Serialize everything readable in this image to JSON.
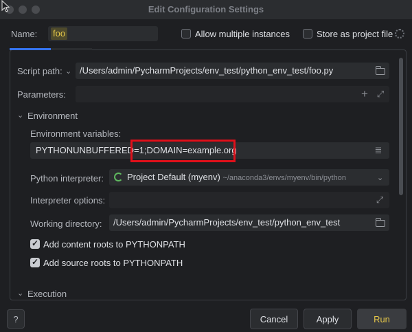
{
  "window": {
    "title": "Edit Configuration Settings"
  },
  "header": {
    "name_label": "Name:",
    "name_value": "foo",
    "allow_multiple_label": "Allow multiple instances",
    "allow_multiple_checked": false,
    "store_project_label": "Store as project file",
    "store_project_checked": false
  },
  "script": {
    "label": "Script path:",
    "value": "/Users/admin/PycharmProjects/env_test/python_env_test/foo.py"
  },
  "parameters": {
    "label": "Parameters:",
    "value": ""
  },
  "environment": {
    "section_label": "Environment",
    "env_vars_label": "Environment variables:",
    "env_vars_prefix": "PYTHONUNBUFFERED=",
    "env_vars_highlighted": "1;DOMAIN=example.org",
    "interpreter_label": "Python interpreter:",
    "interpreter_name": "Project Default (myenv)",
    "interpreter_path": "~/anaconda3/envs/myenv/bin/python",
    "interpreter_options_label": "Interpreter options:",
    "interpreter_options_value": "",
    "workdir_label": "Working directory:",
    "workdir_value": "/Users/admin/PycharmProjects/env_test/python_env_test",
    "content_roots_label": "Add content roots to PYTHONPATH",
    "content_roots_checked": true,
    "source_roots_label": "Add source roots to PYTHONPATH",
    "source_roots_checked": true
  },
  "execution": {
    "section_label": "Execution"
  },
  "footer": {
    "help_label": "?",
    "cancel_label": "Cancel",
    "apply_label": "Apply",
    "run_label": "Run"
  },
  "colors": {
    "accent": "#e6c84a",
    "highlight_box": "#e0101a",
    "background": "#1e1f22"
  }
}
